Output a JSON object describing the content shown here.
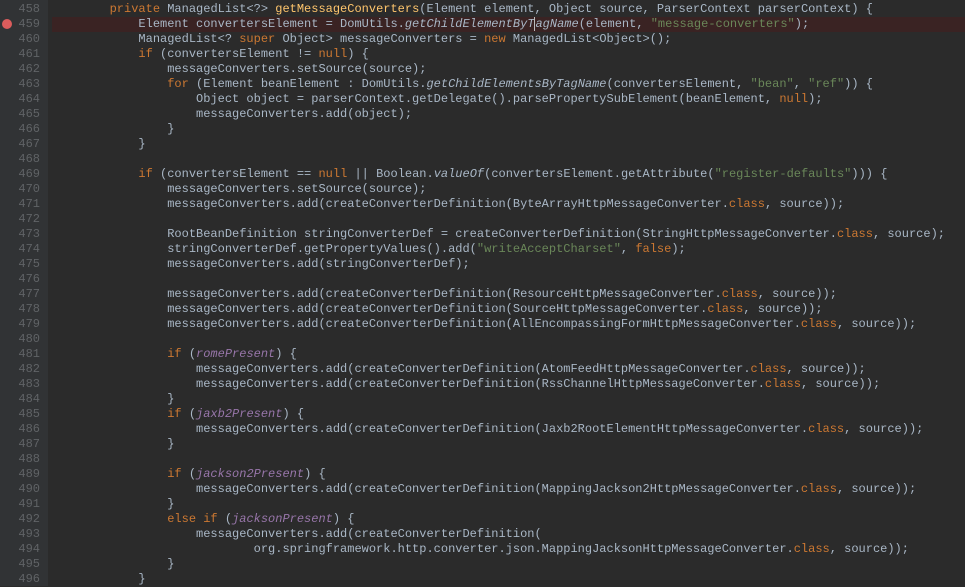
{
  "gutter": {
    "start": 458,
    "end": 496,
    "breakpoint_line": 459
  },
  "code": {
    "lines": [
      {
        "n": 458,
        "indent": 8,
        "tokens": [
          [
            "kw",
            "private"
          ],
          [
            "",
            " ManagedList<?> "
          ],
          [
            "method",
            "getMessageConverters"
          ],
          [
            "",
            "(Element element, Object source, ParserContext parserContext) {"
          ]
        ]
      },
      {
        "n": 459,
        "indent": 12,
        "hl": true,
        "tokens": [
          [
            "",
            "Element convertersElement = DomUtils."
          ],
          [
            "italic-call",
            "getChildElementByT"
          ],
          [
            "cursor",
            ""
          ],
          [
            "italic-call",
            "agName"
          ],
          [
            "",
            "(element, "
          ],
          [
            "string",
            "\"message-converters\""
          ],
          [
            "",
            ");"
          ]
        ]
      },
      {
        "n": 460,
        "indent": 12,
        "tokens": [
          [
            "",
            "ManagedList<? "
          ],
          [
            "kw",
            "super"
          ],
          [
            "",
            " Object> messageConverters = "
          ],
          [
            "kw",
            "new"
          ],
          [
            "",
            " ManagedList<Object>();"
          ]
        ]
      },
      {
        "n": 461,
        "indent": 12,
        "tokens": [
          [
            "kw",
            "if"
          ],
          [
            "",
            " (convertersElement != "
          ],
          [
            "kw",
            "null"
          ],
          [
            "",
            ") {"
          ]
        ]
      },
      {
        "n": 462,
        "indent": 16,
        "tokens": [
          [
            "",
            "messageConverters.setSource(source);"
          ]
        ]
      },
      {
        "n": 463,
        "indent": 16,
        "tokens": [
          [
            "kw",
            "for"
          ],
          [
            "",
            " (Element beanElement : DomUtils."
          ],
          [
            "italic-call",
            "getChildElementsByTagName"
          ],
          [
            "",
            "(convertersElement, "
          ],
          [
            "string",
            "\"bean\""
          ],
          [
            "",
            ", "
          ],
          [
            "string",
            "\"ref\""
          ],
          [
            "",
            ")) {"
          ]
        ]
      },
      {
        "n": 464,
        "indent": 20,
        "tokens": [
          [
            "",
            "Object object = parserContext.getDelegate().parsePropertySubElement(beanElement, "
          ],
          [
            "kw",
            "null"
          ],
          [
            "",
            ");"
          ]
        ]
      },
      {
        "n": 465,
        "indent": 20,
        "tokens": [
          [
            "",
            "messageConverters.add(object);"
          ]
        ]
      },
      {
        "n": 466,
        "indent": 16,
        "tokens": [
          [
            "",
            "}"
          ]
        ]
      },
      {
        "n": 467,
        "indent": 12,
        "tokens": [
          [
            "",
            "}"
          ]
        ]
      },
      {
        "n": 468,
        "indent": 0,
        "tokens": [
          [
            "",
            ""
          ]
        ]
      },
      {
        "n": 469,
        "indent": 12,
        "tokens": [
          [
            "kw",
            "if"
          ],
          [
            "",
            " (convertersElement == "
          ],
          [
            "kw",
            "null"
          ],
          [
            "",
            " || Boolean."
          ],
          [
            "italic-call",
            "valueOf"
          ],
          [
            "",
            "(convertersElement.getAttribute("
          ],
          [
            "string",
            "\"register-defaults\""
          ],
          [
            "",
            "))) {"
          ]
        ]
      },
      {
        "n": 470,
        "indent": 16,
        "tokens": [
          [
            "",
            "messageConverters.setSource(source);"
          ]
        ]
      },
      {
        "n": 471,
        "indent": 16,
        "tokens": [
          [
            "",
            "messageConverters.add(createConverterDefinition(ByteArrayHttpMessageConverter."
          ],
          [
            "kw",
            "class"
          ],
          [
            "",
            ", source));"
          ]
        ]
      },
      {
        "n": 472,
        "indent": 0,
        "tokens": [
          [
            "",
            ""
          ]
        ]
      },
      {
        "n": 473,
        "indent": 16,
        "tokens": [
          [
            "",
            "RootBeanDefinition stringConverterDef = createConverterDefinition(StringHttpMessageConverter."
          ],
          [
            "kw",
            "class"
          ],
          [
            "",
            ", source);"
          ]
        ]
      },
      {
        "n": 474,
        "indent": 16,
        "tokens": [
          [
            "",
            "stringConverterDef.getPropertyValues().add("
          ],
          [
            "string",
            "\"writeAcceptCharset\""
          ],
          [
            "",
            ", "
          ],
          [
            "kw",
            "false"
          ],
          [
            "",
            ");"
          ]
        ]
      },
      {
        "n": 475,
        "indent": 16,
        "tokens": [
          [
            "",
            "messageConverters.add(stringConverterDef);"
          ]
        ]
      },
      {
        "n": 476,
        "indent": 0,
        "tokens": [
          [
            "",
            ""
          ]
        ]
      },
      {
        "n": 477,
        "indent": 16,
        "tokens": [
          [
            "",
            "messageConverters.add(createConverterDefinition(ResourceHttpMessageConverter."
          ],
          [
            "kw",
            "class"
          ],
          [
            "",
            ", source));"
          ]
        ]
      },
      {
        "n": 478,
        "indent": 16,
        "tokens": [
          [
            "",
            "messageConverters.add(createConverterDefinition(SourceHttpMessageConverter."
          ],
          [
            "kw",
            "class"
          ],
          [
            "",
            ", source));"
          ]
        ]
      },
      {
        "n": 479,
        "indent": 16,
        "tokens": [
          [
            "",
            "messageConverters.add(createConverterDefinition(AllEncompassingFormHttpMessageConverter."
          ],
          [
            "kw",
            "class"
          ],
          [
            "",
            ", source));"
          ]
        ]
      },
      {
        "n": 480,
        "indent": 0,
        "tokens": [
          [
            "",
            ""
          ]
        ]
      },
      {
        "n": 481,
        "indent": 16,
        "tokens": [
          [
            "kw",
            "if"
          ],
          [
            "",
            " ("
          ],
          [
            "field",
            "romePresent"
          ],
          [
            "",
            ") {"
          ]
        ]
      },
      {
        "n": 482,
        "indent": 20,
        "tokens": [
          [
            "",
            "messageConverters.add(createConverterDefinition(AtomFeedHttpMessageConverter."
          ],
          [
            "kw",
            "class"
          ],
          [
            "",
            ", source));"
          ]
        ]
      },
      {
        "n": 483,
        "indent": 20,
        "tokens": [
          [
            "",
            "messageConverters.add(createConverterDefinition(RssChannelHttpMessageConverter."
          ],
          [
            "kw",
            "class"
          ],
          [
            "",
            ", source));"
          ]
        ]
      },
      {
        "n": 484,
        "indent": 16,
        "tokens": [
          [
            "",
            "}"
          ]
        ]
      },
      {
        "n": 485,
        "indent": 16,
        "tokens": [
          [
            "kw",
            "if"
          ],
          [
            "",
            " ("
          ],
          [
            "field",
            "jaxb2Present"
          ],
          [
            "",
            ") {"
          ]
        ]
      },
      {
        "n": 486,
        "indent": 20,
        "tokens": [
          [
            "",
            "messageConverters.add(createConverterDefinition(Jaxb2RootElementHttpMessageConverter."
          ],
          [
            "kw",
            "class"
          ],
          [
            "",
            ", source));"
          ]
        ]
      },
      {
        "n": 487,
        "indent": 16,
        "tokens": [
          [
            "",
            "}"
          ]
        ]
      },
      {
        "n": 488,
        "indent": 0,
        "tokens": [
          [
            "",
            ""
          ]
        ]
      },
      {
        "n": 489,
        "indent": 16,
        "tokens": [
          [
            "kw",
            "if"
          ],
          [
            "",
            " ("
          ],
          [
            "field",
            "jackson2Present"
          ],
          [
            "",
            ") {"
          ]
        ]
      },
      {
        "n": 490,
        "indent": 20,
        "tokens": [
          [
            "",
            "messageConverters.add(createConverterDefinition(MappingJackson2HttpMessageConverter."
          ],
          [
            "kw",
            "class"
          ],
          [
            "",
            ", source));"
          ]
        ]
      },
      {
        "n": 491,
        "indent": 16,
        "tokens": [
          [
            "",
            "}"
          ]
        ]
      },
      {
        "n": 492,
        "indent": 16,
        "tokens": [
          [
            "kw",
            "else if"
          ],
          [
            "",
            " ("
          ],
          [
            "field",
            "jacksonPresent"
          ],
          [
            "",
            ") {"
          ]
        ]
      },
      {
        "n": 493,
        "indent": 20,
        "tokens": [
          [
            "",
            "messageConverters.add(createConverterDefinition("
          ]
        ]
      },
      {
        "n": 494,
        "indent": 28,
        "tokens": [
          [
            "",
            "org.springframework.http.converter.json.MappingJacksonHttpMessageConverter."
          ],
          [
            "kw",
            "class"
          ],
          [
            "",
            ", source));"
          ]
        ]
      },
      {
        "n": 495,
        "indent": 16,
        "tokens": [
          [
            "",
            "}"
          ]
        ]
      },
      {
        "n": 496,
        "indent": 12,
        "tokens": [
          [
            "",
            "}"
          ]
        ]
      }
    ]
  }
}
